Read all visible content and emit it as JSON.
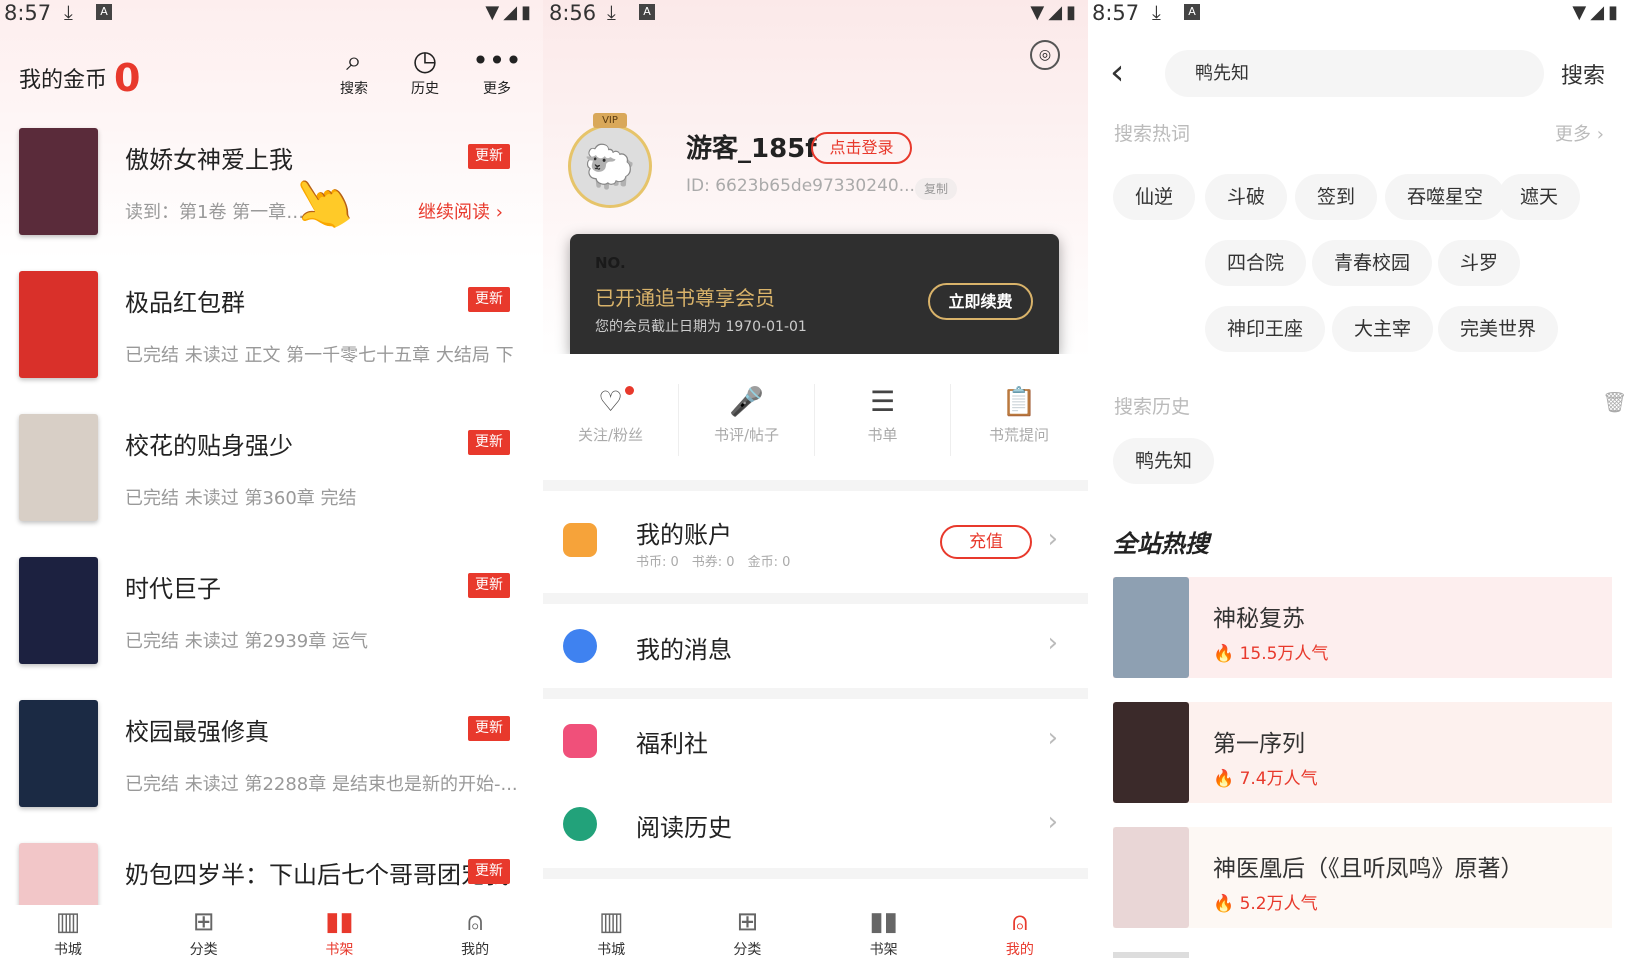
{
  "colors": {
    "accent": "#e8392c",
    "gold": "#d9b36a"
  },
  "panel1": {
    "status": {
      "time": "8:57"
    },
    "coins": {
      "label": "我的金币",
      "value": "0"
    },
    "actions": [
      {
        "icon": "search-icon",
        "label": "搜索"
      },
      {
        "icon": "history-icon",
        "label": "历史"
      },
      {
        "icon": "more-icon",
        "label": "更多"
      }
    ],
    "books": [
      {
        "title": "傲娇女神爱上我",
        "badge": "更新",
        "sub": "读到：第1卷 第一章 ...",
        "continue": "继续阅读 ›",
        "cover": "#5a2b3a"
      },
      {
        "title": "极品红包群",
        "badge": "更新",
        "sub": "已完结 未读过 正文 第一千零七十五章 大结局 下",
        "cover": "#d9302a"
      },
      {
        "title": "校花的贴身强少",
        "badge": "更新",
        "sub": "已完结 未读过 第360章 完结",
        "cover": "#d8cfc6"
      },
      {
        "title": "时代巨子",
        "badge": "更新",
        "sub": "已完结 未读过 第2939章 运气",
        "cover": "#1c2140"
      },
      {
        "title": "校园最强修真",
        "badge": "更新",
        "sub": "已完结 未读过 第2288章 是结束也是新的开始-...",
        "cover": "#1b2a44"
      },
      {
        "title": "奶包四岁半：下山后七个哥哥团宠我",
        "badge": "更新",
        "sub": "",
        "cover": "#f2c6c8"
      }
    ],
    "nav": [
      {
        "icon": "bookstore-icon",
        "label": "书城"
      },
      {
        "icon": "category-icon",
        "label": "分类"
      },
      {
        "icon": "bookshelf-icon",
        "label": "书架",
        "active": true
      },
      {
        "icon": "profile-icon",
        "label": "我的"
      }
    ]
  },
  "panel2": {
    "status": {
      "time": "8:56"
    },
    "vip_tag": "VIP",
    "username": "游客_185f",
    "login_button": "点击登录",
    "user_id": "ID: 6623b65de97330240...",
    "copy_button": "复制",
    "card": {
      "no": "NO.",
      "title": "已开通追书尊享会员",
      "expiry": "您的会员截止日期为 1970-01-01",
      "renew": "立即续费"
    },
    "shortcuts": [
      {
        "icon": "heart-icon",
        "label": "关注/粉丝"
      },
      {
        "icon": "microphone-icon",
        "label": "书评/帖子"
      },
      {
        "icon": "booklist-icon",
        "label": "书单"
      },
      {
        "icon": "clipboard-icon",
        "label": "书荒提问"
      }
    ],
    "account": {
      "label": "我的账户",
      "stats": "书币: 0　书券: 0　金币: 0",
      "recharge": "充值"
    },
    "menu": [
      {
        "icon": "message-icon",
        "label": "我的消息"
      },
      {
        "icon": "gift-icon",
        "label": "福利社"
      },
      {
        "icon": "reading-history-icon",
        "label": "阅读历史"
      }
    ],
    "nav": [
      {
        "icon": "bookstore-icon",
        "label": "书城"
      },
      {
        "icon": "category-icon",
        "label": "分类"
      },
      {
        "icon": "bookshelf-icon",
        "label": "书架"
      },
      {
        "icon": "profile-icon",
        "label": "我的",
        "active": true
      }
    ]
  },
  "panel3": {
    "status": {
      "time": "8:57"
    },
    "search_value": "鸭先知",
    "search_button": "搜索",
    "hot_words_title": "搜索热词",
    "more": "更多",
    "hot_words": [
      "仙逆",
      "斗破",
      "签到",
      "吞噬星空",
      "遮天",
      "四合院",
      "青春校园",
      "斗罗",
      "神印王座",
      "大主宰",
      "完美世界"
    ],
    "history_title": "搜索历史",
    "history": [
      "鸭先知"
    ],
    "trending_title": "全站热搜",
    "trending": [
      {
        "title": "神秘复苏",
        "pop": "15.5万人气",
        "cover": "#8ea0b2",
        "bg": "#fdeeee"
      },
      {
        "title": "第一序列",
        "pop": "7.4万人气",
        "cover": "#3b2a2a",
        "bg": "#fdf1ee"
      },
      {
        "title": "神医凰后（《且听凤鸣》原著）",
        "pop": "5.2万人气",
        "cover": "#e9d6d6",
        "bg": "#fdf8f4"
      }
    ]
  }
}
